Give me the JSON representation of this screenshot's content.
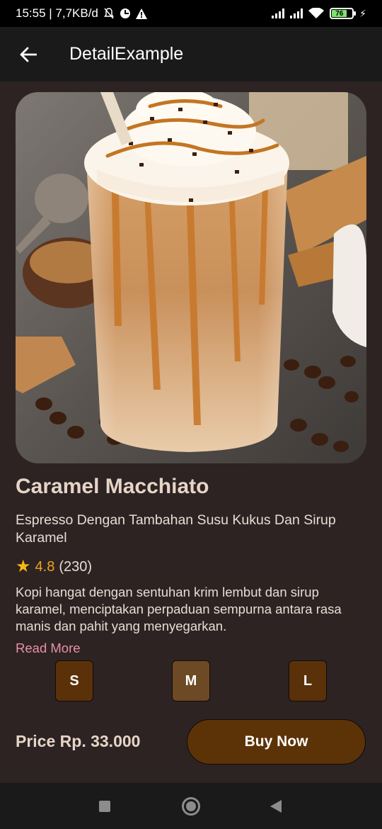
{
  "status_bar": {
    "time_speed": "15:55 | 7,7KB/d",
    "battery_level": "76",
    "icons": [
      "notifications-off-icon",
      "data-saver-icon",
      "warning-icon",
      "signal-icon",
      "signal-icon",
      "wifi-icon",
      "battery-icon",
      "charging-icon"
    ]
  },
  "app_bar": {
    "title": "DetailExample",
    "back_icon": "arrow-left-icon"
  },
  "product": {
    "name": "Caramel Macchiato",
    "subtitle": "Espresso Dengan Tambahan Susu Kukus Dan Sirup Karamel",
    "rating": "4.8",
    "rating_count": "(230)",
    "description": "Kopi hangat dengan sentuhan krim lembut dan sirup karamel, menciptakan perpaduan sempurna antara rasa manis dan pahit yang menyegarkan.",
    "read_more": "Read More"
  },
  "sizes": {
    "options": [
      "S",
      "M",
      "L"
    ],
    "selected": "M"
  },
  "purchase": {
    "price": "Price Rp. 33.000",
    "buy_label": "Buy Now"
  },
  "colors": {
    "background": "#2d2323",
    "button": "#5c3307",
    "selected_size": "#6d4a25",
    "rating": "#f0a31e",
    "link": "#e98fae"
  }
}
